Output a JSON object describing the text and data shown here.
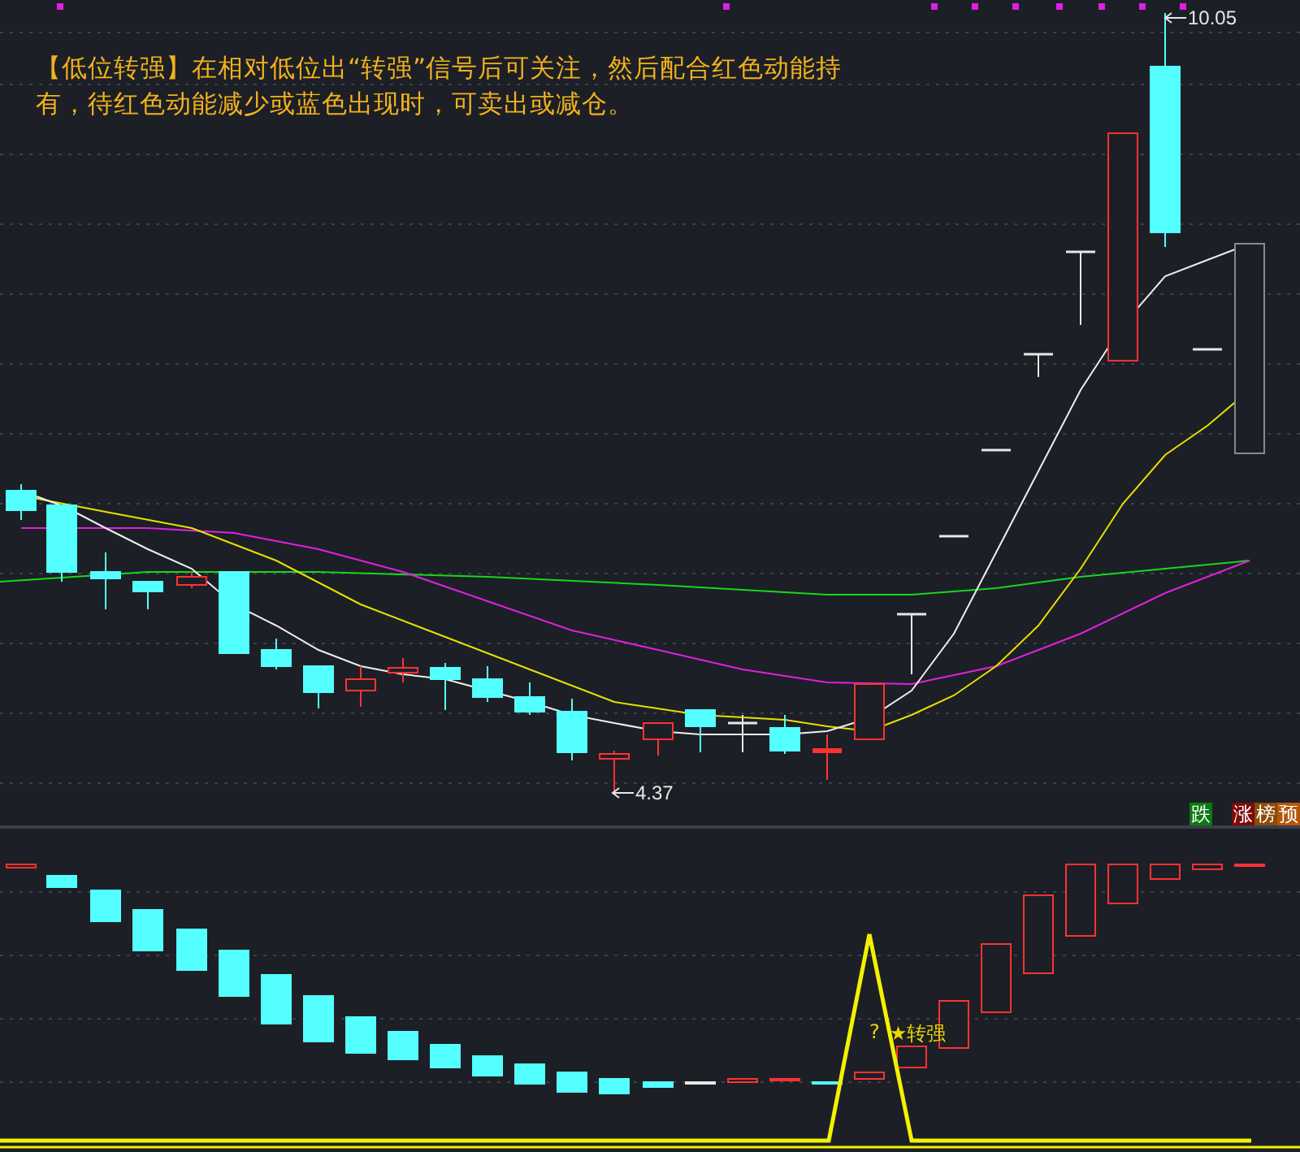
{
  "annotation": {
    "text": "【低位转强】在相对低位出“转强”信号后可关注，然后配合红色动能持有，待红色动能减少或蓝色出现时，可卖出或减仓。"
  },
  "price_labels": [
    {
      "text": "10.05"
    },
    {
      "text": "4.37"
    }
  ],
  "badges": [
    {
      "text": "跌",
      "color": "#0b7a12"
    },
    {
      "text": "涨",
      "color": "#7d0a0a"
    },
    {
      "text": "榜",
      "color": "#8c4a08"
    },
    {
      "text": "预",
      "color": "#b4560c"
    }
  ],
  "signal": {
    "marks": [
      "?",
      "★转强"
    ]
  }
}
